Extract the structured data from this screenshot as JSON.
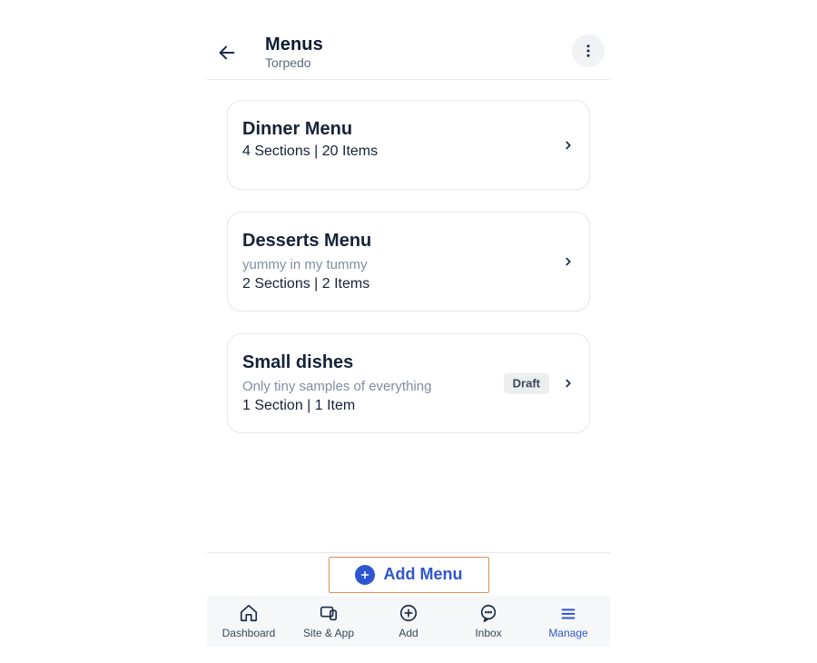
{
  "header": {
    "title": "Menus",
    "subtitle": "Torpedo"
  },
  "menus": [
    {
      "title": "Dinner Menu",
      "description": "",
      "meta": "4 Sections | 20 Items",
      "badge": ""
    },
    {
      "title": "Desserts Menu",
      "description": "yummy in my tummy",
      "meta": "2 Sections | 2 Items",
      "badge": ""
    },
    {
      "title": "Small dishes",
      "description": "Only tiny samples of everything",
      "meta": "1 Section | 1 Item",
      "badge": "Draft"
    }
  ],
  "actions": {
    "add_menu": "Add Menu"
  },
  "nav": [
    {
      "label": "Dashboard",
      "active": false
    },
    {
      "label": "Site & App",
      "active": false
    },
    {
      "label": "Add",
      "active": false
    },
    {
      "label": "Inbox",
      "active": false
    },
    {
      "label": "Manage",
      "active": true
    }
  ]
}
